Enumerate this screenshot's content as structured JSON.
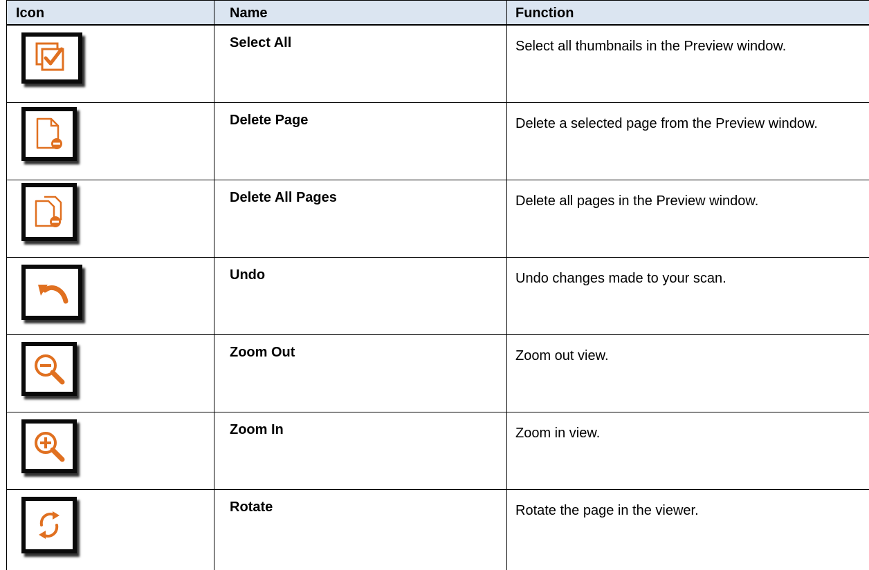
{
  "table": {
    "headers": {
      "icon": "Icon",
      "name": "Name",
      "function": "Function"
    },
    "accent_color": "#e07020",
    "header_bg": "#dbe5f1",
    "rows": [
      {
        "icon": "select-all-icon",
        "name": "Select All",
        "function": "Select all thumbnails in the Preview window."
      },
      {
        "icon": "delete-page-icon",
        "name": "Delete Page",
        "function": "Delete a selected page from the Preview window."
      },
      {
        "icon": "delete-all-pages-icon",
        "name": "Delete All Pages",
        "function": "Delete all pages in the Preview window."
      },
      {
        "icon": "undo-icon",
        "name": "Undo",
        "function": "Undo changes made to your scan."
      },
      {
        "icon": "zoom-out-icon",
        "name": "Zoom Out",
        "function": "Zoom out view."
      },
      {
        "icon": "zoom-in-icon",
        "name": "Zoom In",
        "function": "Zoom in view."
      },
      {
        "icon": "rotate-icon",
        "name": "Rotate",
        "function": "Rotate the page in the viewer."
      }
    ]
  }
}
